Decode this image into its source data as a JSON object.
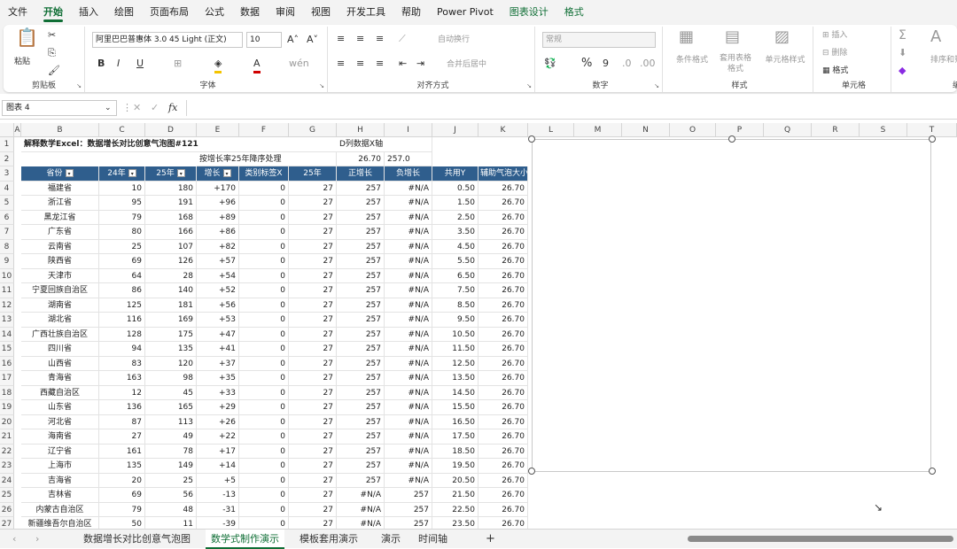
{
  "menu": [
    "文件",
    "开始",
    "插入",
    "绘图",
    "页面布局",
    "公式",
    "数据",
    "审阅",
    "视图",
    "开发工具",
    "帮助",
    "Power Pivot",
    "图表设计",
    "格式"
  ],
  "ribbon": {
    "paste": "粘贴",
    "clipboard": "剪贴板",
    "font_name": "阿里巴巴普惠体 3.0 45 Light (正文)",
    "font_size": "10",
    "font_group": "字体",
    "align_group": "对齐方式",
    "wrap": "自动换行",
    "merge": "合并后居中",
    "num_format": "常规",
    "number_group": "数字",
    "cond_format": "条件格式",
    "table_format": "套用表格格式",
    "cell_style": "单元格样式",
    "styles_group": "样式",
    "insert": "插入",
    "delete": "删除",
    "format": "格式",
    "cells_group": "单元格",
    "sort_filter": "排序和筛选",
    "edit_group": "编"
  },
  "formula_bar": {
    "name_box": "图表 4",
    "fx": "fx",
    "value": ""
  },
  "columns": [
    "A",
    "B",
    "C",
    "D",
    "E",
    "F",
    "G",
    "H",
    "I",
    "J",
    "K",
    "L",
    "M",
    "N",
    "O",
    "P",
    "Q",
    "R",
    "S",
    "T"
  ],
  "rows": [
    {
      "n": "1",
      "title": "解释数学Excel：数据增长对比创意气泡图#121",
      "g": "D列数据X轴"
    },
    {
      "n": "2",
      "note": "按增长率25年降序处理",
      "g": "26.70",
      "h": "257.0"
    }
  ],
  "table_header": [
    "省份",
    "24年",
    "25年",
    "增长",
    "类别标签X",
    "25年",
    "正增长",
    "负增长",
    "共用Y",
    "辅助气泡大小"
  ],
  "table_rows": [
    [
      "4",
      "福建省",
      "10",
      "180",
      "+170",
      "0",
      "27",
      "257",
      "#N/A",
      "0.50",
      "26.70"
    ],
    [
      "5",
      "浙江省",
      "95",
      "191",
      "+96",
      "0",
      "27",
      "257",
      "#N/A",
      "1.50",
      "26.70"
    ],
    [
      "6",
      "黑龙江省",
      "79",
      "168",
      "+89",
      "0",
      "27",
      "257",
      "#N/A",
      "2.50",
      "26.70"
    ],
    [
      "7",
      "广东省",
      "80",
      "166",
      "+86",
      "0",
      "27",
      "257",
      "#N/A",
      "3.50",
      "26.70"
    ],
    [
      "8",
      "云南省",
      "25",
      "107",
      "+82",
      "0",
      "27",
      "257",
      "#N/A",
      "4.50",
      "26.70"
    ],
    [
      "9",
      "陕西省",
      "69",
      "126",
      "+57",
      "0",
      "27",
      "257",
      "#N/A",
      "5.50",
      "26.70"
    ],
    [
      "10",
      "天津市",
      "64",
      "28",
      "+54",
      "0",
      "27",
      "257",
      "#N/A",
      "6.50",
      "26.70"
    ],
    [
      "11",
      "宁夏回族自治区",
      "86",
      "140",
      "+52",
      "0",
      "27",
      "257",
      "#N/A",
      "7.50",
      "26.70"
    ],
    [
      "12",
      "湖南省",
      "125",
      "181",
      "+56",
      "0",
      "27",
      "257",
      "#N/A",
      "8.50",
      "26.70"
    ],
    [
      "13",
      "湖北省",
      "116",
      "169",
      "+53",
      "0",
      "27",
      "257",
      "#N/A",
      "9.50",
      "26.70"
    ],
    [
      "14",
      "广西壮族自治区",
      "128",
      "175",
      "+47",
      "0",
      "27",
      "257",
      "#N/A",
      "10.50",
      "26.70"
    ],
    [
      "15",
      "四川省",
      "94",
      "135",
      "+41",
      "0",
      "27",
      "257",
      "#N/A",
      "11.50",
      "26.70"
    ],
    [
      "16",
      "山西省",
      "83",
      "120",
      "+37",
      "0",
      "27",
      "257",
      "#N/A",
      "12.50",
      "26.70"
    ],
    [
      "17",
      "青海省",
      "163",
      "98",
      "+35",
      "0",
      "27",
      "257",
      "#N/A",
      "13.50",
      "26.70"
    ],
    [
      "18",
      "西藏自治区",
      "12",
      "45",
      "+33",
      "0",
      "27",
      "257",
      "#N/A",
      "14.50",
      "26.70"
    ],
    [
      "19",
      "山东省",
      "136",
      "165",
      "+29",
      "0",
      "27",
      "257",
      "#N/A",
      "15.50",
      "26.70"
    ],
    [
      "20",
      "河北省",
      "87",
      "113",
      "+26",
      "0",
      "27",
      "257",
      "#N/A",
      "16.50",
      "26.70"
    ],
    [
      "21",
      "海南省",
      "27",
      "49",
      "+22",
      "0",
      "27",
      "257",
      "#N/A",
      "17.50",
      "26.70"
    ],
    [
      "22",
      "辽宁省",
      "161",
      "78",
      "+17",
      "0",
      "27",
      "257",
      "#N/A",
      "18.50",
      "26.70"
    ],
    [
      "23",
      "上海市",
      "135",
      "149",
      "+14",
      "0",
      "27",
      "257",
      "#N/A",
      "19.50",
      "26.70"
    ],
    [
      "24",
      "吉海省",
      "20",
      "25",
      "+5",
      "0",
      "27",
      "257",
      "#N/A",
      "20.50",
      "26.70"
    ],
    [
      "25",
      "吉林省",
      "69",
      "56",
      "-13",
      "0",
      "27",
      "#N/A",
      "257",
      "21.50",
      "26.70"
    ],
    [
      "26",
      "内蒙古自治区",
      "79",
      "48",
      "-31",
      "0",
      "27",
      "#N/A",
      "257",
      "22.50",
      "26.70"
    ],
    [
      "27",
      "新疆维吾尔自治区",
      "50",
      "11",
      "-39",
      "0",
      "27",
      "#N/A",
      "257",
      "23.50",
      "26.70"
    ]
  ],
  "sheet_tabs": [
    "数据增长对比创意气泡图",
    "数学式制作演示",
    "模板套用演示",
    "演示",
    "时间轴"
  ],
  "active_tab": 1
}
